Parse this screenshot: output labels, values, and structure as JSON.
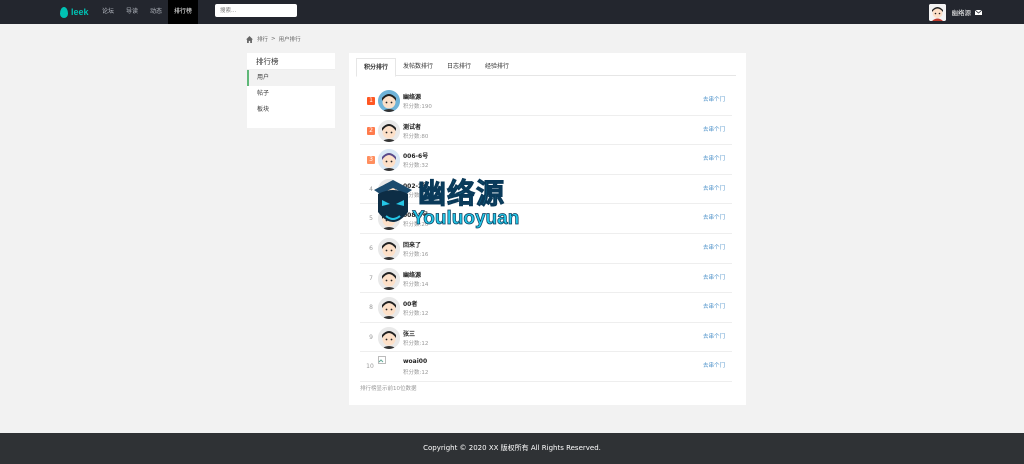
{
  "header": {
    "logo_text": "leek",
    "nav": [
      {
        "label": "论坛"
      },
      {
        "label": "导读"
      },
      {
        "label": "动态"
      },
      {
        "label": "排行榜"
      }
    ],
    "search_placeholder": "搜索...",
    "user_name": "幽络源"
  },
  "breadcrumb": [
    "排行",
    ">",
    "用户排行"
  ],
  "sidebar": {
    "title": "排行榜",
    "items": [
      {
        "label": "用户"
      },
      {
        "label": "帖子"
      },
      {
        "label": "板块"
      }
    ]
  },
  "tabs": [
    "积分排行",
    "发帖数排行",
    "日志排行",
    "经验排行"
  ],
  "ranking": [
    {
      "rank": "1",
      "name": "幽络源",
      "score": "积分数:190",
      "action": "去串个门"
    },
    {
      "rank": "2",
      "name": "测试者",
      "score": "积分数:80",
      "action": "去串个门"
    },
    {
      "rank": "3",
      "name": "006-6号",
      "score": "积分数:32",
      "action": "去串个门"
    },
    {
      "rank": "4",
      "name": "002-2号",
      "score": "积分数:28",
      "action": "去串个门"
    },
    {
      "rank": "5",
      "name": "008-8号",
      "score": "积分数:20",
      "action": "去串个门"
    },
    {
      "rank": "6",
      "name": "回来了",
      "score": "积分数:16",
      "action": "去串个门"
    },
    {
      "rank": "7",
      "name": "幽络源",
      "score": "积分数:14",
      "action": "去串个门"
    },
    {
      "rank": "8",
      "name": "00者",
      "score": "积分数:12",
      "action": "去串个门"
    },
    {
      "rank": "9",
      "name": "张三",
      "score": "积分数:12",
      "action": "去串个门"
    },
    {
      "rank": "10",
      "name": "woai00",
      "score": "积分数:12",
      "action": "去串个门"
    }
  ],
  "footnote": "排行榜显示前10位数据",
  "watermark": {
    "cn": "幽络源",
    "en": "Youluoyuan"
  },
  "footer": "Copyright  ©  2020  XX 版权所有 All Rights Reserved."
}
